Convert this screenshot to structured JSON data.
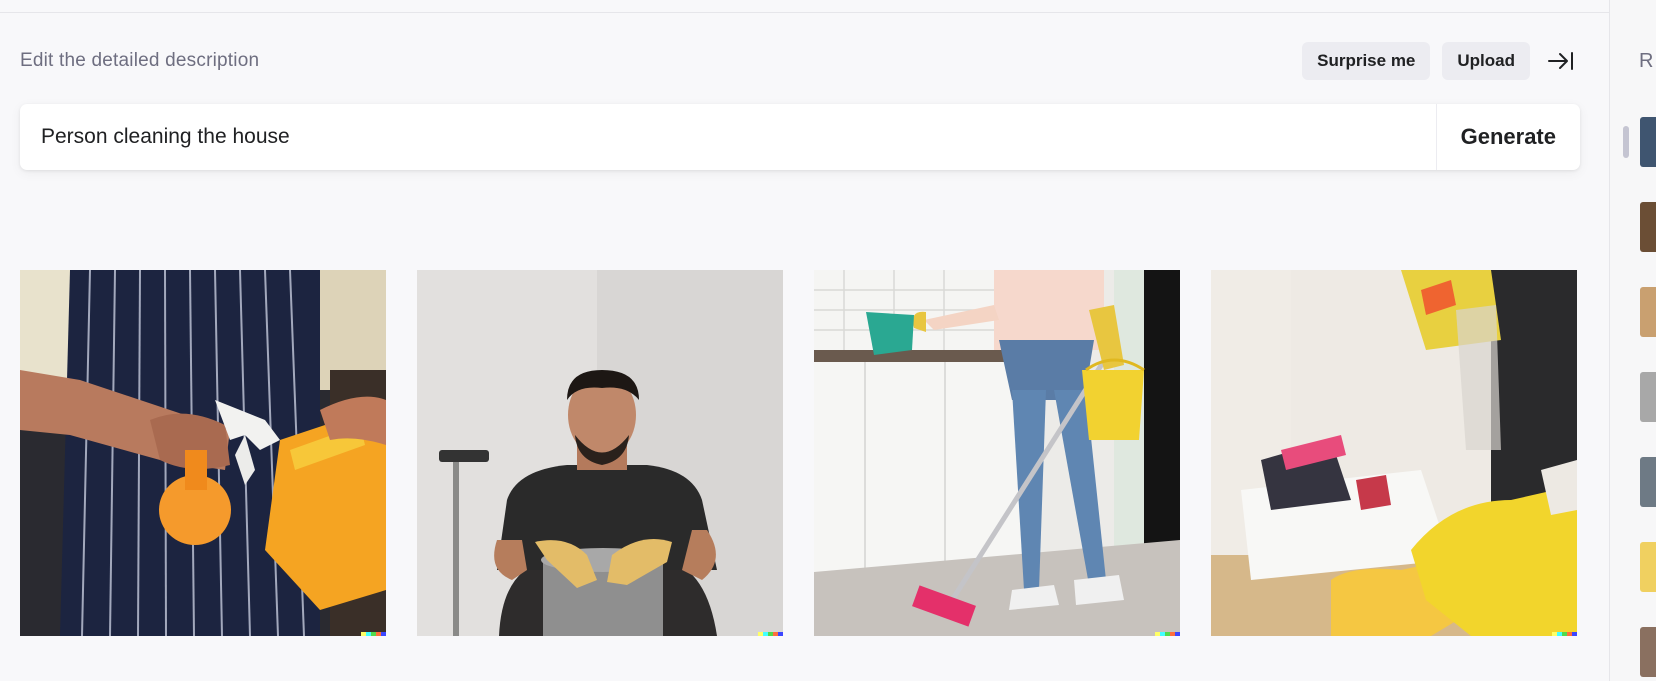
{
  "header": {
    "subtitle": "Edit the detailed description",
    "surprise_label": "Surprise me",
    "upload_label": "Upload",
    "collapse_icon": "arrow-right-to-line-icon"
  },
  "prompt": {
    "value": "Person cleaning the house",
    "generate_label": "Generate"
  },
  "results": [
    {
      "name": "result-image-1",
      "subject": "man-in-apron-spray-bottle"
    },
    {
      "name": "result-image-2",
      "subject": "man-in-bucket-with-gloves"
    },
    {
      "name": "result-image-3",
      "subject": "person-mopping-floor"
    },
    {
      "name": "result-image-4",
      "subject": "hand-wiping-table"
    }
  ],
  "signature_colors": [
    "#ffff66",
    "#42ffff",
    "#51da4c",
    "#ff6e3c",
    "#3c46ff"
  ],
  "sidebar": {
    "title": "R",
    "thumb_colors": [
      "#3f5570",
      "#6b4e35",
      "#c9a070",
      "#a8a8a8",
      "#6e7a85",
      "#f0d060",
      "#8a7060"
    ]
  }
}
